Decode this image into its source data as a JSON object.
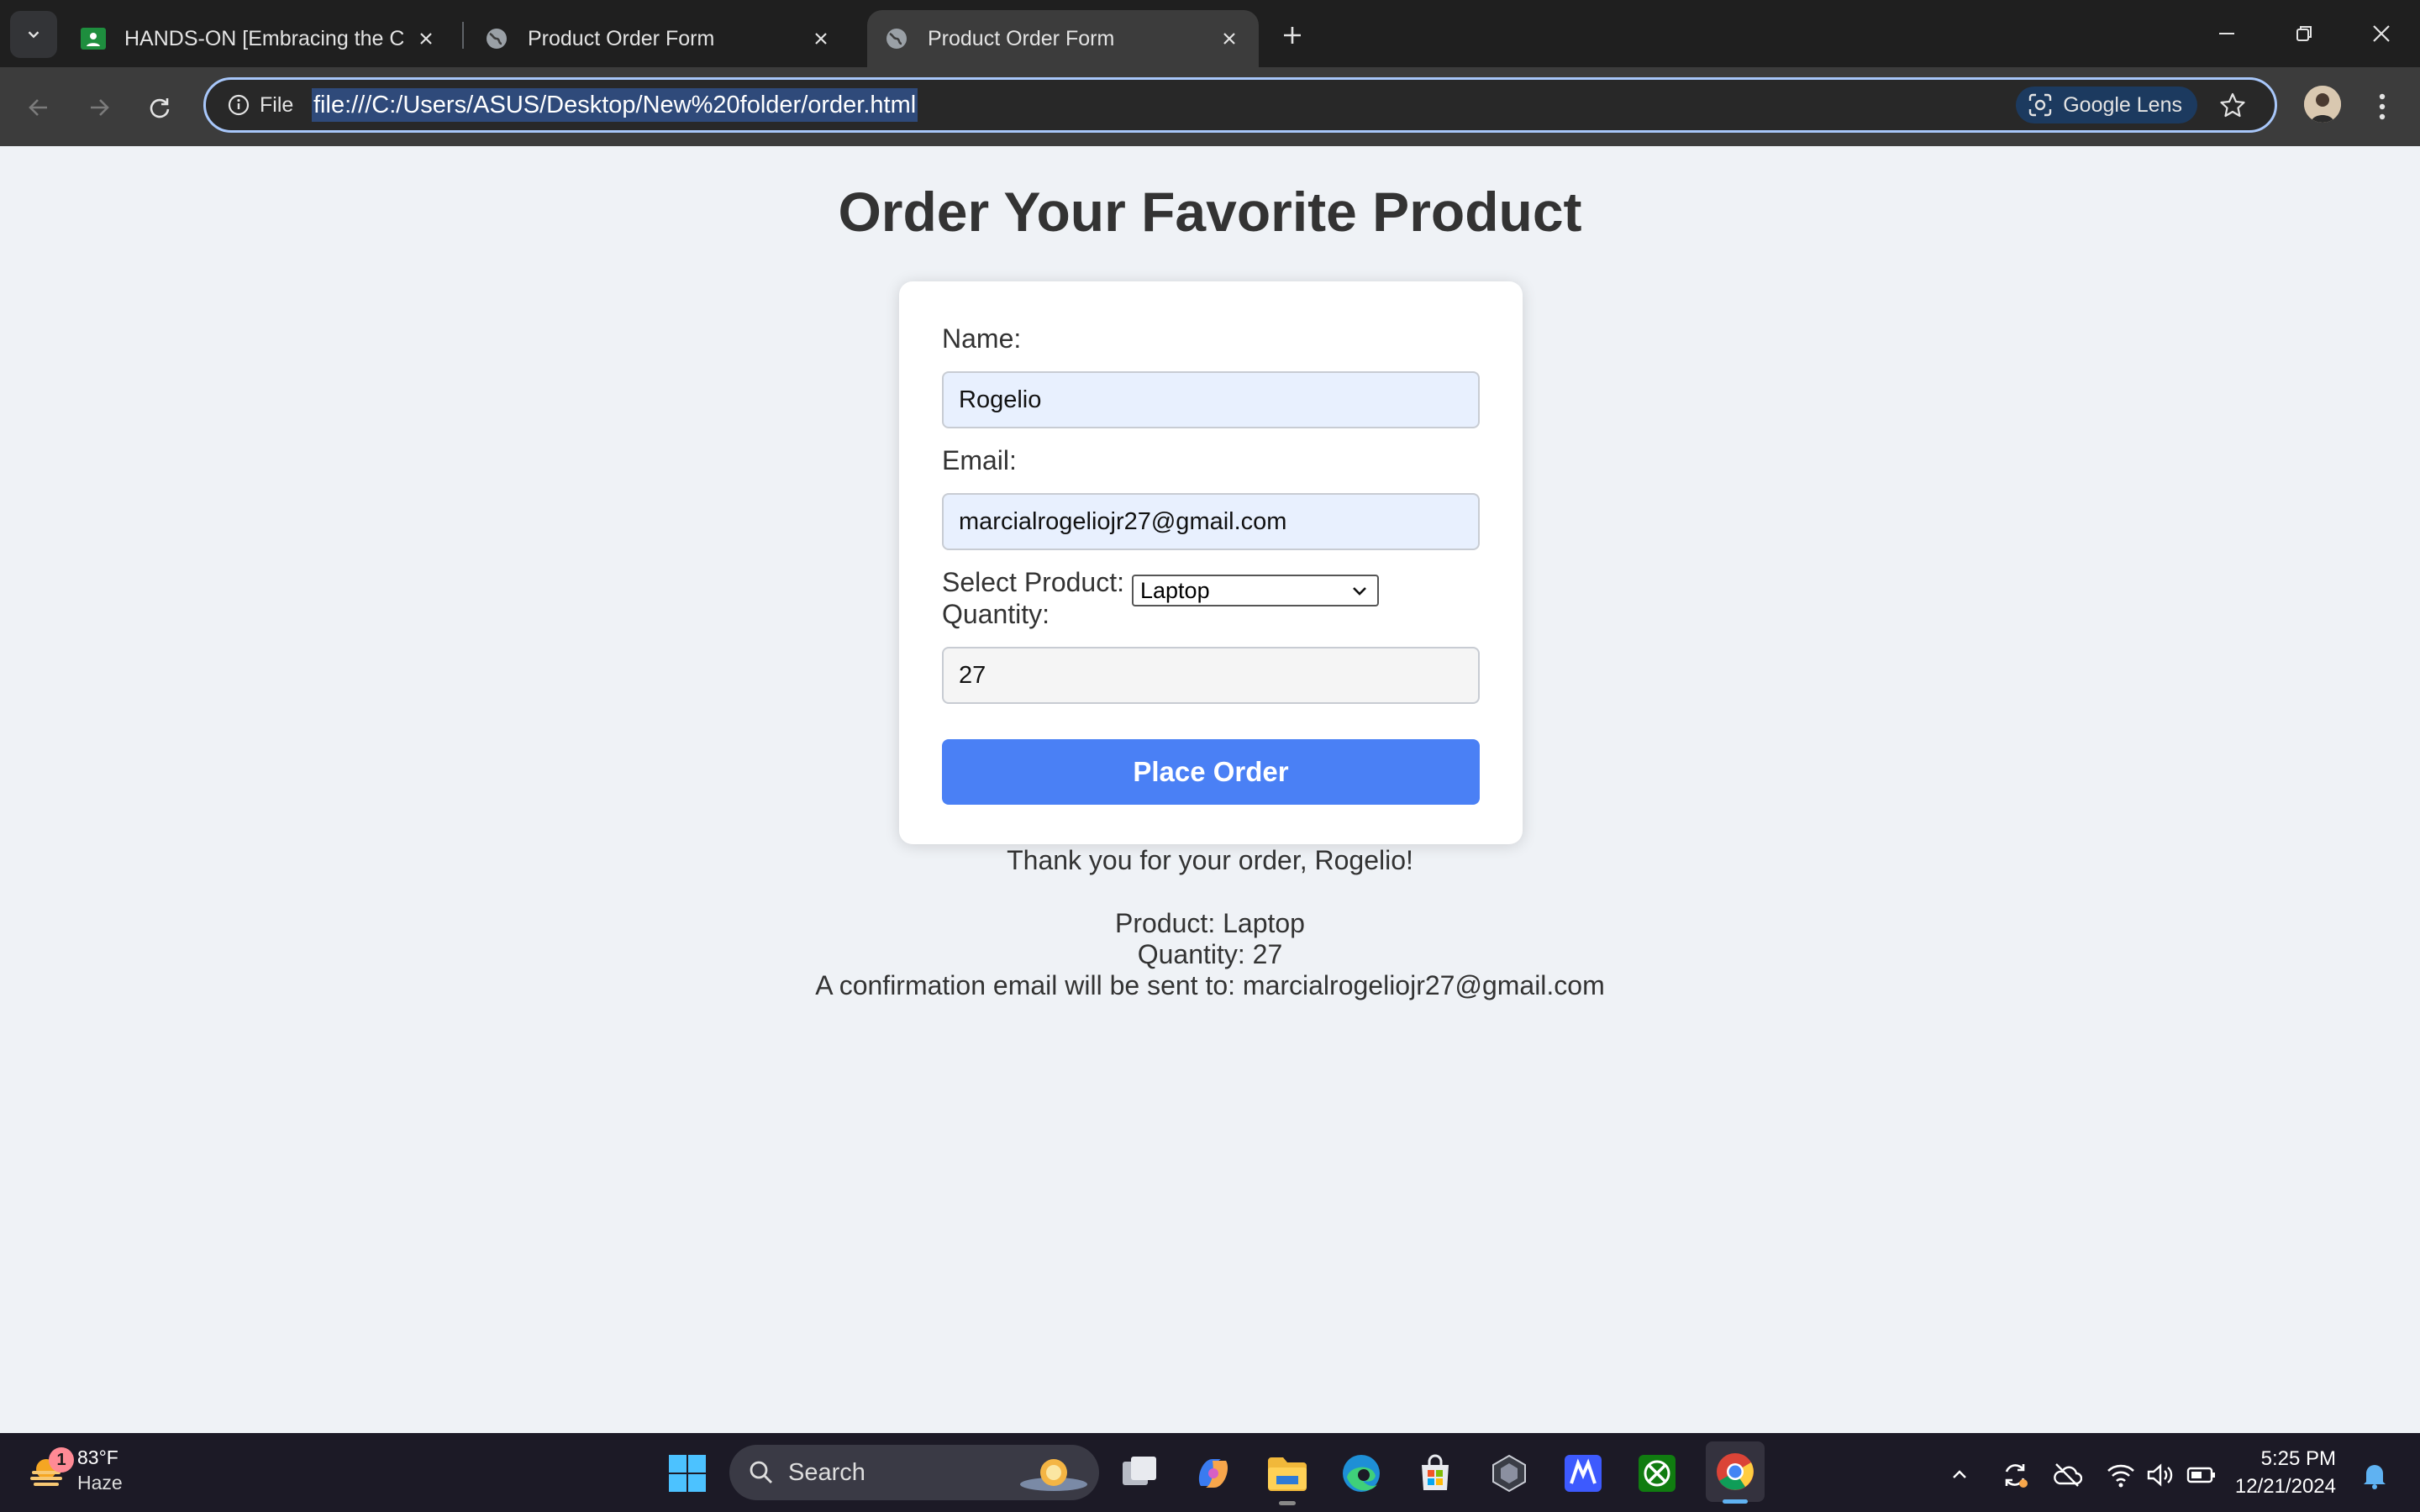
{
  "browser": {
    "tabs": [
      {
        "title": "HANDS-ON [Embracing the Co",
        "favicon": "google-classroom-icon",
        "active": false
      },
      {
        "title": "Product Order Form",
        "favicon": "globe-icon",
        "active": false
      },
      {
        "title": "Product Order Form",
        "favicon": "globe-icon",
        "active": true
      }
    ],
    "site_chip": "File",
    "url": "file:///C:/Users/ASUS/Desktop/New%20folder/order.html",
    "lens_label": "Google Lens"
  },
  "page": {
    "title": "Order Your Favorite Product",
    "form": {
      "name_label": "Name:",
      "name_value": "Rogelio",
      "email_label": "Email:",
      "email_value": "marcialrogeliojr27@gmail.com",
      "product_label": "Select Product:",
      "product_value": "Laptop",
      "quantity_label": "Quantity:",
      "quantity_value": "27",
      "submit_label": "Place Order"
    },
    "result": {
      "thanks": "Thank you for your order, Rogelio!",
      "product_line": "Product: Laptop",
      "quantity_line": "Quantity: 27",
      "email_line": "A confirmation email will be sent to: marcialrogeliojr27@gmail.com"
    }
  },
  "taskbar": {
    "weather_temp": "83°F",
    "weather_cond": "Haze",
    "weather_badge": "1",
    "search_placeholder": "Search",
    "time": "5:25 PM",
    "date": "12/21/2024"
  },
  "colors": {
    "accent_button": "#4a80f5",
    "page_bg": "#eff2f6",
    "autofill_bg": "#e8f0fe"
  }
}
